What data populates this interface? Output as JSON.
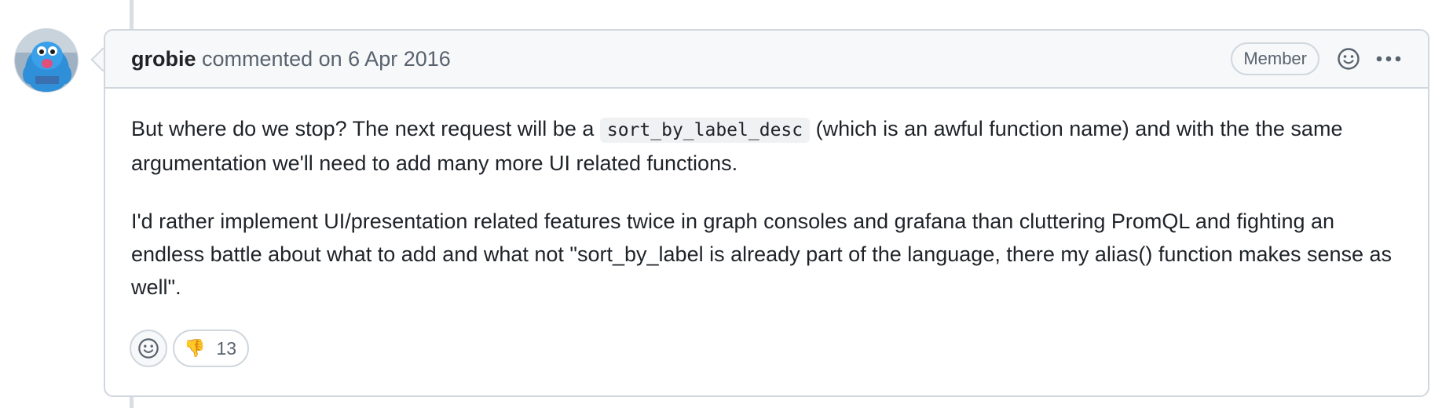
{
  "comment": {
    "author": "grobie",
    "action": "commented on",
    "date": "6 Apr 2016",
    "badge": "Member",
    "body": {
      "p1_before_code": "But where do we stop? The next request will be a ",
      "p1_code": "sort_by_label_desc",
      "p1_after_code": " (which is an awful function name) and with the the same argumentation we'll need to add many more UI related functions.",
      "p2": "I'd rather implement UI/presentation related features twice in graph consoles and grafana than cluttering PromQL and fighting an endless battle about what to add and what not \"sort_by_label is already part of the language, there my alias() function makes sense as well\"."
    },
    "reactions": [
      {
        "emoji": "👎",
        "icon": "thumbs-down-icon",
        "count": "13"
      }
    ]
  },
  "icons": {
    "header_emoji": "smiley-icon",
    "header_more": "kebab-horizontal-icon",
    "add_reaction": "smiley-icon"
  },
  "colors": {
    "border": "#d0d7de",
    "header_bg": "#f6f8fa",
    "muted_text": "#59636e",
    "text": "#1f2328",
    "avatar_blue": "#2f8fd8"
  }
}
